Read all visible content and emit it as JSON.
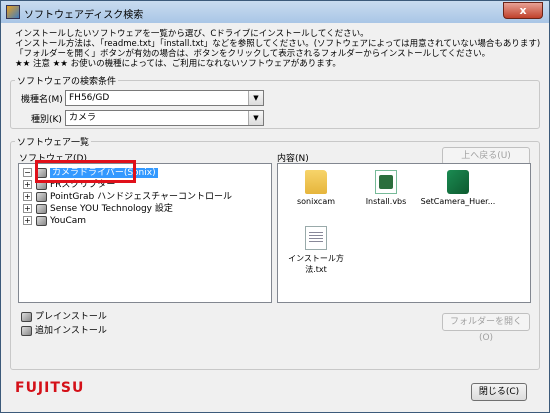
{
  "window": {
    "title": "ソフトウェアディスク検索",
    "close_label": "x"
  },
  "instructions": [
    "インストールしたいソフトウェアを一覧から選び、Cドライブにインストールしてください。",
    "インストール方法は、「readme.txt」「install.txt」などを参照してください。(ソフトウェアによっては用意されていない場合もあります)",
    "「フォルダーを開く」ボタンが有効の場合は、ボタンをクリックして表示されるフォルダーからインストールしてください。",
    "★★ 注意 ★★ お使いの機種によっては、ご利用になれないソフトウェアがあります。"
  ],
  "search": {
    "legend": "ソフトウェアの検索条件",
    "model_label": "機種名(M)",
    "model_value": "FH56/GD",
    "category_label": "種別(K)",
    "category_value": "カメラ"
  },
  "list": {
    "legend": "ソフトウェア一覧",
    "software_label": "ソフトウェア(D)",
    "contents_label": "内容(N)",
    "up_button": "上へ戻る(U)",
    "tree": [
      {
        "label": "カメラドライバー(Sonix)",
        "selected": true
      },
      {
        "label": "FRスクリプター"
      },
      {
        "label": "PointGrab ハンドジェスチャーコントロール"
      },
      {
        "label": "Sense YOU Technology 設定"
      },
      {
        "label": "YouCam"
      }
    ],
    "files": [
      {
        "name": "sonixcam",
        "icon": "folder-icon"
      },
      {
        "name": "Install.vbs",
        "icon": "script-icon"
      },
      {
        "name": "SetCamera_Huer...",
        "icon": "exe-icon"
      },
      {
        "name": "インストール方法.txt",
        "icon": "text-file-icon"
      }
    ],
    "open_folder_button": "フォルダーを開く(O)"
  },
  "legend_items": {
    "preinstall": "プレインストール",
    "additional": "追加インストール"
  },
  "footer": {
    "logo": "FUJITSU",
    "close_button": "閉じる(C)"
  }
}
